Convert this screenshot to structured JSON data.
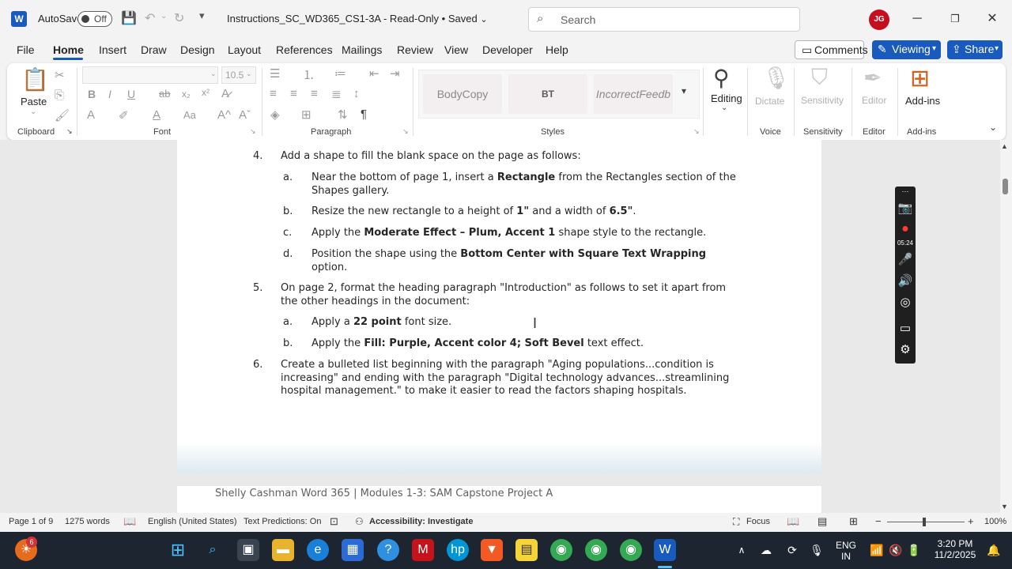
{
  "titlebar": {
    "app_icon": "W",
    "autosave_label": "AutoSave",
    "autosave_state": "Off",
    "doc_title": "Instructions_SC_WD365_CS1-3A  -  Read-Only • Saved",
    "search_placeholder": "Search",
    "avatar_initials": "JG"
  },
  "menu": {
    "items": [
      "File",
      "Home",
      "Insert",
      "Draw",
      "Design",
      "Layout",
      "References",
      "Mailings",
      "Review",
      "View",
      "Developer",
      "Help"
    ],
    "comments_label": "Comments",
    "viewing_label": "Viewing",
    "share_label": "Share"
  },
  "ribbon": {
    "paste_label": "Paste",
    "font_size": "10.5",
    "groups": {
      "clipboard": "Clipboard",
      "font": "Font",
      "paragraph": "Paragraph",
      "styles": "Styles",
      "voice": "Voice",
      "sensitivity": "Sensitivity",
      "editor": "Editor",
      "addins": "Add-ins"
    },
    "styles": [
      "BodyCopy",
      "BT",
      "IncorrectFeedb"
    ],
    "editing_label": "Editing",
    "dictate_label": "Dictate",
    "sensitivity_label": "Sensitivity",
    "editor_label": "Editor",
    "addins_label": "Add-ins"
  },
  "document": {
    "step4": {
      "num": "4.",
      "text": "Add a shape to fill the blank space on the page as follows:"
    },
    "step4a": {
      "letter": "a.",
      "pre": " Near the bottom of page 1, insert a ",
      "bold": "Rectangle",
      "post": " from the Rectangles section of the",
      "line2": "Shapes gallery."
    },
    "step4b": {
      "letter": "b.",
      "pre": " Resize the new rectangle to a height of ",
      "bold1": "1\"",
      "mid": " and a width of ",
      "bold2": "6.5\"",
      "post": "."
    },
    "step4c": {
      "letter": "c.",
      "pre": " Apply the ",
      "bold": "Moderate Effect – Plum, Accent 1",
      "post": " shape style to the rectangle."
    },
    "step4d": {
      "letter": "d.",
      "pre": " Position the shape using the ",
      "bold": "Bottom Center with Square Text Wrapping",
      "line2": "option."
    },
    "step5": {
      "num": "5.",
      "line1": "On page 2, format the heading paragraph \"Introduction\" as follows to set it apart from",
      "line2": "the other headings in the document:"
    },
    "step5a": {
      "letter": "a.",
      "pre": "Apply a ",
      "bold": "22 point",
      "post": " font size."
    },
    "step5b": {
      "letter": "b.",
      "pre": "Apply the ",
      "bold": "Fill: Purple, Accent color 4; Soft Bevel",
      "post": " text effect."
    },
    "step6": {
      "num": "6.",
      "line1": "Create a bulleted list beginning with the paragraph \"Aging populations...condition is",
      "line2": "increasing\" and ending with the paragraph \"Digital technology advances...streamlining",
      "line3": "hospital management.\" to make it easier to read the factors shaping hospitals."
    },
    "page2_footer": "Shelly Cashman Word 365 | Modules 1-3: SAM Capstone Project A"
  },
  "recorder": {
    "timer": "05:24"
  },
  "statusbar": {
    "page": "Page 1 of 9",
    "words": "1275 words",
    "language": "English (United States)",
    "predictions": "Text Predictions: On",
    "accessibility": "Accessibility: Investigate",
    "focus": "Focus",
    "zoom": "100%"
  },
  "taskbar": {
    "badge_count": "6",
    "lang_line1": "ENG",
    "lang_line2": "IN",
    "time": "3:20 PM",
    "date": "11/2/2025"
  },
  "colors": {
    "accent": "#185abd",
    "recorder_bg": "#1f1f1f",
    "taskbar_bg": "#1c2530"
  }
}
